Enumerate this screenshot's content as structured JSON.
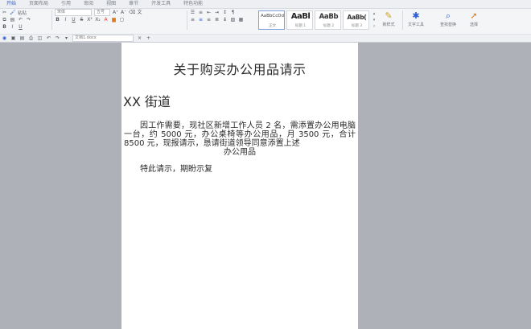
{
  "ribbon": {
    "tabs": [
      "开始",
      "页面布局",
      "引用",
      "审阅",
      "视图",
      "章节",
      "开发工具",
      "特色功能"
    ],
    "active_tab_index": 0,
    "clipboard": {
      "paste_label": "粘贴"
    },
    "font": {
      "name": "宋体",
      "size": "五号"
    },
    "styles": [
      {
        "sample": "AaBbCcDd",
        "caption": "正文"
      },
      {
        "sample": "AaBl",
        "caption": "标题 1"
      },
      {
        "sample": "AaBb",
        "caption": "标题 2"
      },
      {
        "sample": "AaBb(",
        "caption": "标题 3"
      }
    ],
    "tools": {
      "new_style": "新样式",
      "text_tools": "文字工具",
      "find_replace": "查找替换",
      "select": "选择"
    },
    "quick_bar": {
      "tab_label": "文档1.docx"
    }
  },
  "document": {
    "title": "关于购买办公用品请示",
    "recipient": "XX 街道",
    "body": "因工作需要，现社区新增工作人员 2 名，需添置办公用电脑一台，约 5000 元，办公桌椅等办公用品，月 3500 元，合计 8500 元，现报请示，恳请街道领导同意添置上述",
    "body_tail": "办公用品",
    "closing": "特此请示，期盼示复"
  },
  "colors": {
    "accent": "#2f62c9",
    "canvas": "#aeb1b8",
    "page": "#ffffff"
  }
}
